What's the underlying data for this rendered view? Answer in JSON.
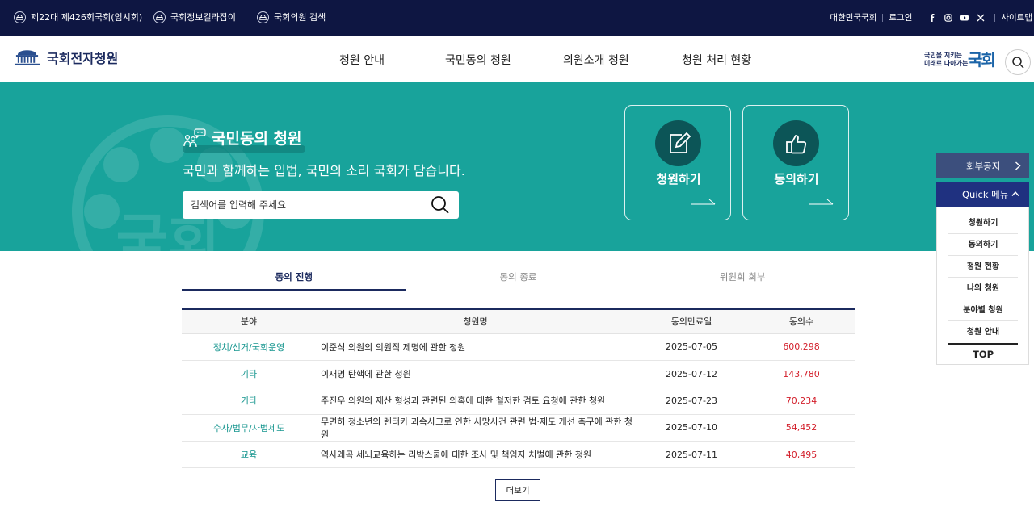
{
  "topbar": {
    "left_links": [
      "제22대 제426회국회(임시회)",
      "국회정보길라잡이",
      "국회의원 검색"
    ],
    "right_links": [
      "대한민국국회",
      "로그인",
      "사이트맵"
    ],
    "sns_icons": [
      "facebook-icon",
      "instagram-icon",
      "youtube-icon",
      "x-icon"
    ]
  },
  "header": {
    "logo_text": "국회전자청원",
    "nav": [
      "청원 안내",
      "국민동의 청원",
      "의원소개 청원",
      "청원 처리 현황"
    ],
    "brand_line1": "국민을 지키는",
    "brand_line2": "미래로 나아가는",
    "brand_word": "국회"
  },
  "hero": {
    "title": "국민동의 청원",
    "subtitle": "국민과 함께하는 입법, 국민의 소리 국회가 담습니다.",
    "search_placeholder": "검색어를 입력해 주세요",
    "bg_text": "국회",
    "cards": [
      {
        "label": "청원하기",
        "icon": "pen-icon"
      },
      {
        "label": "동의하기",
        "icon": "thumbs-up-icon"
      }
    ]
  },
  "tabs": [
    "동의 진행",
    "동의 종료",
    "위원회 회부"
  ],
  "table": {
    "headers": [
      "분야",
      "청원명",
      "동의만료일",
      "동의수"
    ],
    "rows": [
      {
        "category": "정치/선거/국회운영",
        "title": "이준석 의원의 의원직 제명에 관한 청원",
        "date": "2025-07-05",
        "count": "600,298"
      },
      {
        "category": "기타",
        "title": "이재명 탄핵에 관한 청원",
        "date": "2025-07-12",
        "count": "143,780"
      },
      {
        "category": "기타",
        "title": "주진우 의원의 재산 형성과 관련된 의혹에 대한 철저한 검토 요청에 관한 청원",
        "date": "2025-07-23",
        "count": "70,234"
      },
      {
        "category": "수사/법무/사법제도",
        "title": "무면허 청소년의 렌터카 과속사고로 인한 사망사건 관련 법·제도 개선 촉구에 관한 청원",
        "date": "2025-07-10",
        "count": "54,452"
      },
      {
        "category": "교육",
        "title": "역사왜곡 세뇌교육하는 리박스쿨에 대한 조사 및 책임자 처벌에 관한 청원",
        "date": "2025-07-11",
        "count": "40,495"
      }
    ]
  },
  "more_label": "더보기",
  "quick": {
    "notice": "회부공지",
    "menu": "Quick 메뉴",
    "items": [
      "청원하기",
      "동의하기",
      "청원 현황",
      "나의 청원",
      "분야별 청원",
      "청원 안내"
    ],
    "top": "TOP"
  }
}
